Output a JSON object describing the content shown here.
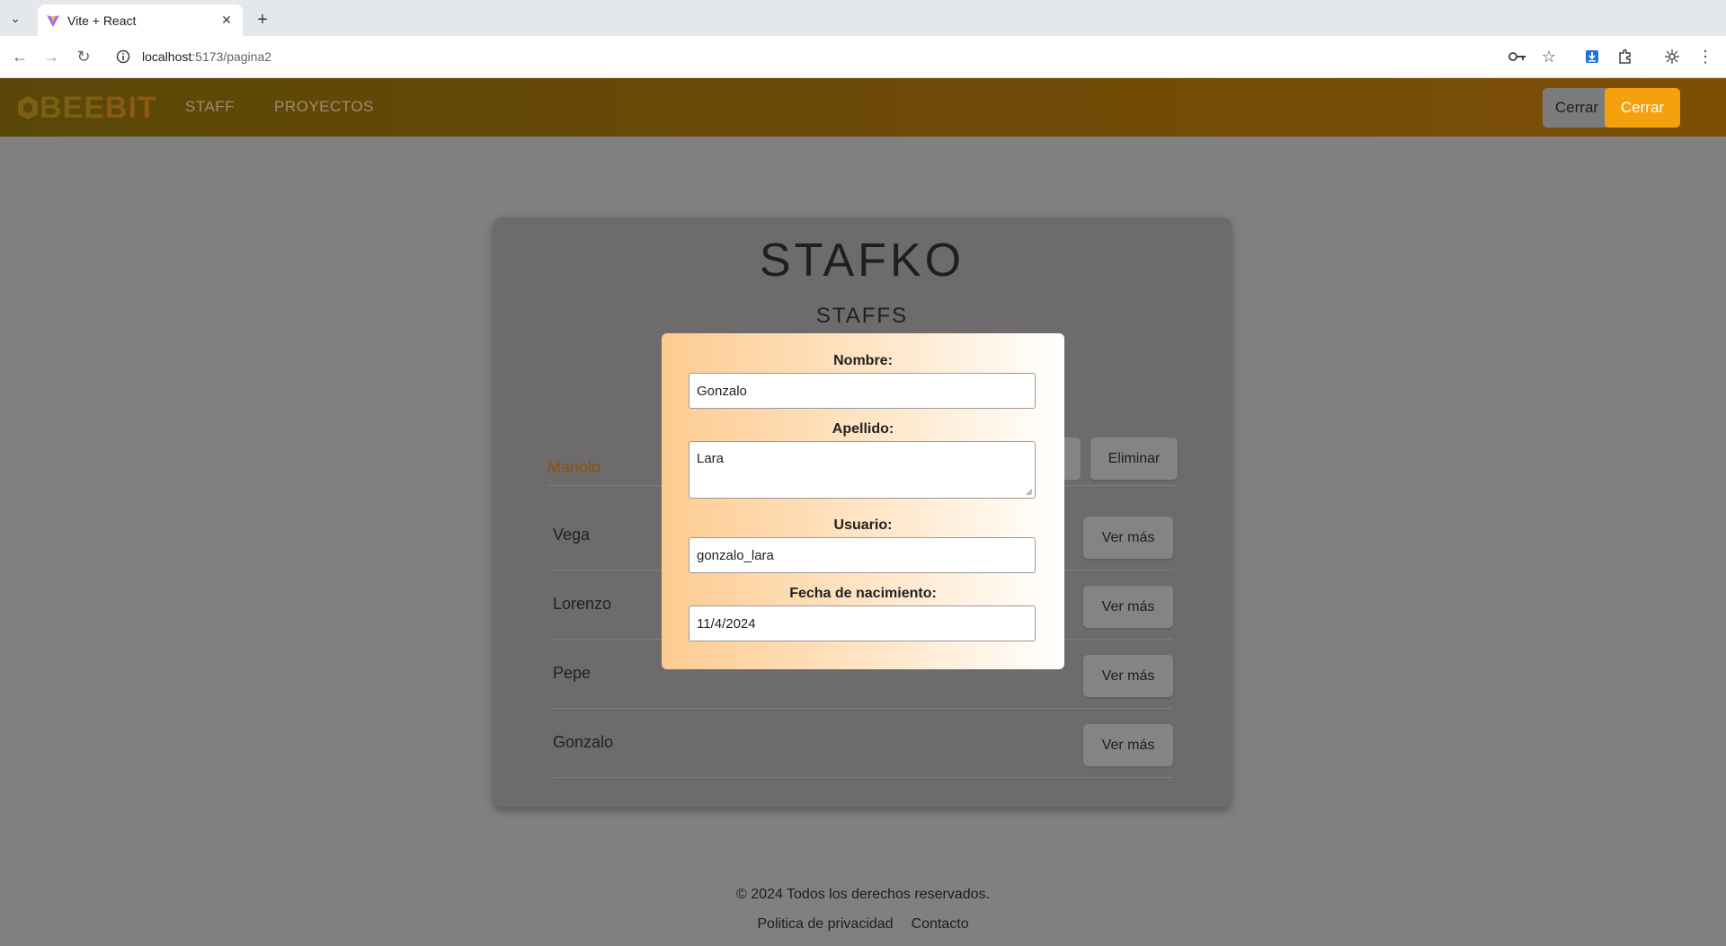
{
  "browser": {
    "tab_title": "Vite + React",
    "url_host": "localhost",
    "url_path": ":5173/pagina2"
  },
  "navbar": {
    "logo_part1": "BEE",
    "logo_part2": "BIT",
    "links": [
      "STAFF",
      "PROYECTOS"
    ],
    "cerrar_grey": "Cerrar",
    "cerrar_orange": "Cerrar",
    "accent_color": "#f5a00d"
  },
  "card": {
    "title": "STAFKO",
    "subtitle": "STAFFS",
    "active_row": {
      "name": "Manolo",
      "delete_label": "Eliminar"
    },
    "rows": [
      {
        "name": "Vega",
        "button": "Ver más"
      },
      {
        "name": "Lorenzo",
        "button": "Ver más"
      },
      {
        "name": "Pepe",
        "button": "Ver más"
      },
      {
        "name": "Gonzalo",
        "button": "Ver más"
      }
    ]
  },
  "modal": {
    "nombre_label": "Nombre:",
    "nombre_value": "Gonzalo",
    "apellido_label": "Apellido:",
    "apellido_value": "Lara",
    "usuario_label": "Usuario:",
    "usuario_value": "gonzalo_lara",
    "fecha_label": "Fecha de nacimiento:",
    "fecha_value": "11/4/2024"
  },
  "footer": {
    "copyright": "© 2024 Todos los derechos reservados.",
    "links": [
      "Politica de privacidad",
      "Contacto"
    ]
  }
}
